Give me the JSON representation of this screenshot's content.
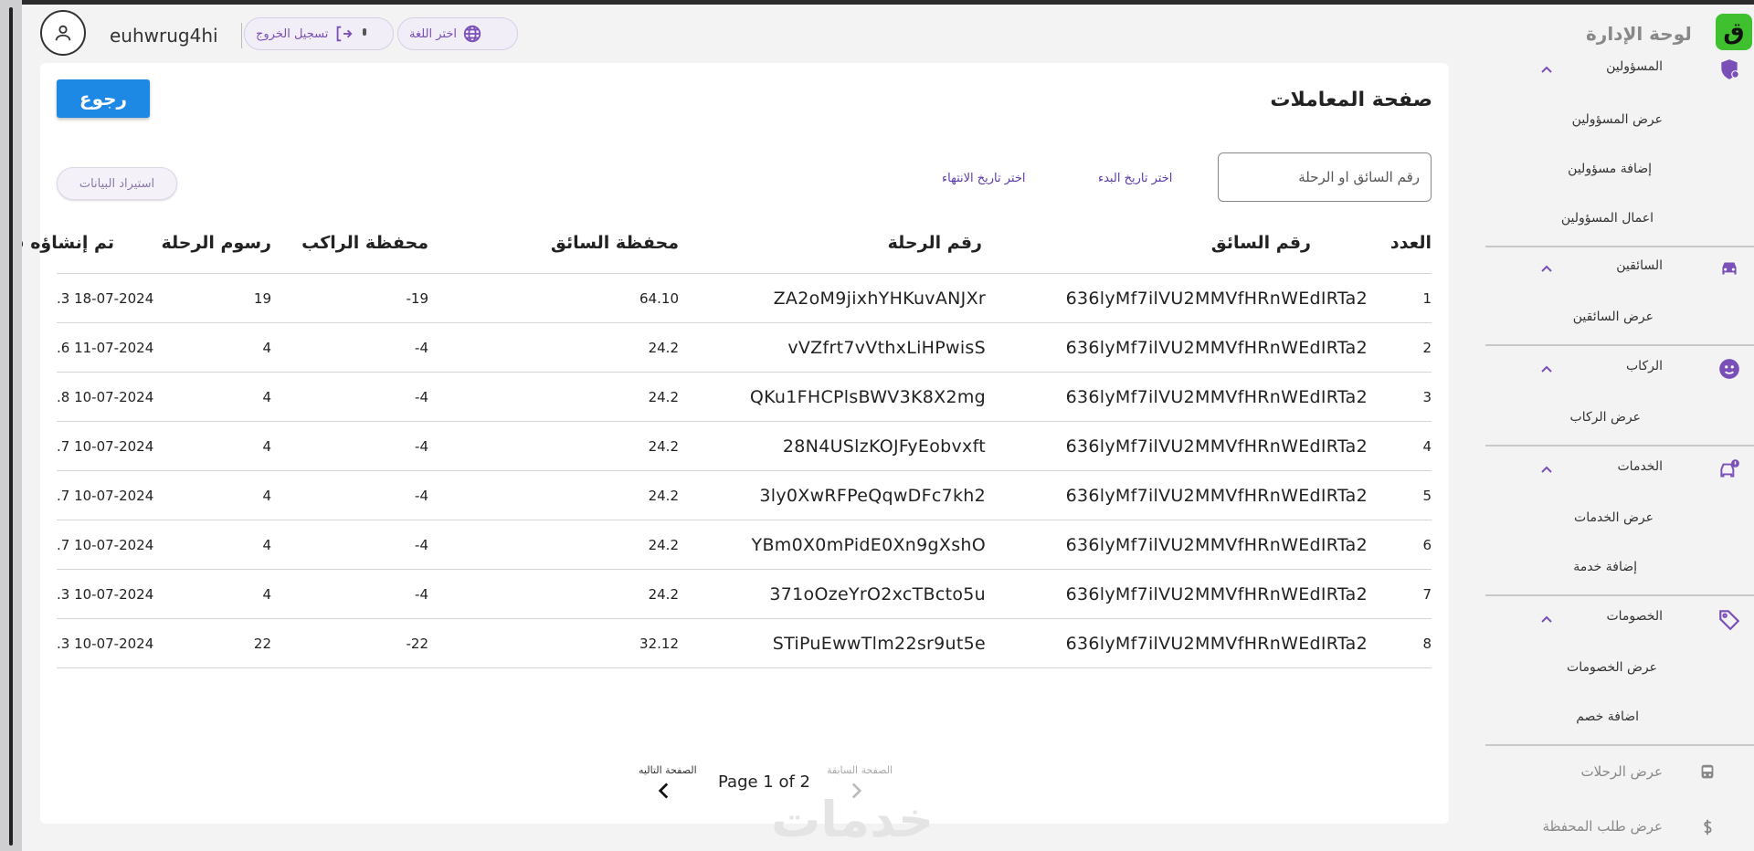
{
  "header": {
    "username": "euhwrug4hi",
    "logout_label": "تسجيل الخروج",
    "language_label": "اختر اللغة",
    "brand_title": "لوحة الإدارة",
    "brand_logo_letter": "ق",
    "accent_color": "#7a4fb8"
  },
  "main": {
    "title": "صفحة المعاملات",
    "back_label": "رجوع",
    "search_placeholder": "رقم السائق او الرحلة",
    "start_date_label": "اختر تاريخ البدء",
    "end_date_label": "اختر تاريخ الانتهاء",
    "export_label": "استيراد البيانات",
    "columns": [
      "العدد",
      "رقم السائق",
      "رقم الرحلة",
      "محفظة السائق",
      "محفظة الراكب",
      "رسوم الرحلة",
      "تم إنشاؤه في"
    ],
    "rows": [
      {
        "num": "1",
        "driver": "636lyMf7ilVU2MMVfHRnWEdIRTa2",
        "trip": "ZA2oM9jixhYHKuvANJXr",
        "driver_wallet": "64.10",
        "rider_wallet": "-19",
        "fee": "19",
        "created": ".3 18-07-2024"
      },
      {
        "num": "2",
        "driver": "636lyMf7ilVU2MMVfHRnWEdIRTa2",
        "trip": "vVZfrt7vVthxLiHPwisS",
        "driver_wallet": "24.2",
        "rider_wallet": "-4",
        "fee": "4",
        "created": ".6 11-07-2024"
      },
      {
        "num": "3",
        "driver": "636lyMf7ilVU2MMVfHRnWEdIRTa2",
        "trip": "QKu1FHCPlsBWV3K8X2mg",
        "driver_wallet": "24.2",
        "rider_wallet": "-4",
        "fee": "4",
        "created": ".8 10-07-2024"
      },
      {
        "num": "4",
        "driver": "636lyMf7ilVU2MMVfHRnWEdIRTa2",
        "trip": "28N4USlzKOJFyEobvxft",
        "driver_wallet": "24.2",
        "rider_wallet": "-4",
        "fee": "4",
        "created": ".7 10-07-2024"
      },
      {
        "num": "5",
        "driver": "636lyMf7ilVU2MMVfHRnWEdIRTa2",
        "trip": "3ly0XwRFPeQqwDFc7kh2",
        "driver_wallet": "24.2",
        "rider_wallet": "-4",
        "fee": "4",
        "created": ".7 10-07-2024"
      },
      {
        "num": "6",
        "driver": "636lyMf7ilVU2MMVfHRnWEdIRTa2",
        "trip": "YBm0X0mPidE0Xn9gXshO",
        "driver_wallet": "24.2",
        "rider_wallet": "-4",
        "fee": "4",
        "created": ".7 10-07-2024"
      },
      {
        "num": "7",
        "driver": "636lyMf7ilVU2MMVfHRnWEdIRTa2",
        "trip": "371oOzeYrO2xcTBcto5u",
        "driver_wallet": "24.2",
        "rider_wallet": "-4",
        "fee": "4",
        "created": ".3 10-07-2024"
      },
      {
        "num": "8",
        "driver": "636lyMf7ilVU2MMVfHRnWEdIRTa2",
        "trip": "STiPuEwwTlm22sr9ut5e",
        "driver_wallet": "32.12",
        "rider_wallet": "-22",
        "fee": "22",
        "created": ".3 10-07-2024"
      }
    ],
    "pagination": {
      "text": "Page 1 of 2",
      "next_label": "الصفحة التاليه",
      "prev_label": "الصفحة السابقة"
    },
    "watermark": "خدمات"
  },
  "sidebar": {
    "sections": [
      {
        "label": "المسؤولين",
        "icon": "shield-icon",
        "items": [
          "عرض المسؤولين",
          "إضافة مسؤولين",
          "اعمال المسؤولين"
        ]
      },
      {
        "label": "السائقين",
        "icon": "car-icon",
        "items": [
          "عرض السائقين"
        ]
      },
      {
        "label": "الركاب",
        "icon": "smiley-icon",
        "items": [
          "عرض الركاب"
        ]
      },
      {
        "label": "الخدمات",
        "icon": "services-car-icon",
        "items": [
          "عرض الخدمات",
          "إضافة خدمة"
        ]
      },
      {
        "label": "الخصومات",
        "icon": "tag-icon",
        "items": [
          "عرض الخصومات",
          "اضافة خصم"
        ]
      }
    ],
    "trips_label": "عرض الرحلات",
    "wallet_requests_label": "عرض طلب المحفظة"
  }
}
